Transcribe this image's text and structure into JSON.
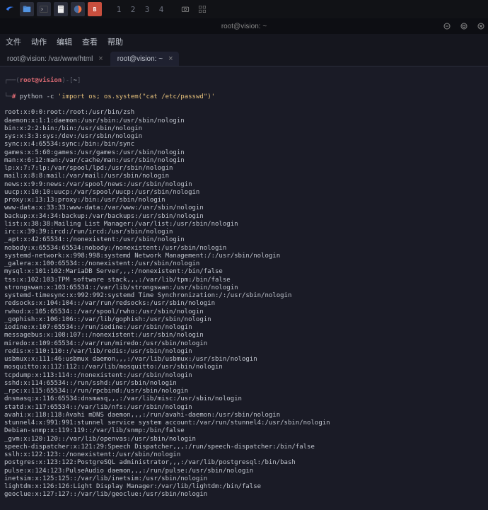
{
  "taskbar": {
    "workspaces": [
      "1",
      "2",
      "3",
      "4"
    ]
  },
  "window": {
    "title": "root@vision: ~"
  },
  "menu": {
    "file": "文件",
    "actions": "动作",
    "edit": "编辑",
    "view": "查看",
    "help": "帮助"
  },
  "tabs": [
    {
      "label": "root@vision: /var/www/html",
      "active": false
    },
    {
      "label": "root@vision: ~",
      "active": true
    }
  ],
  "prompt": {
    "user": "root",
    "at": "@",
    "host": "vision",
    "path": "~",
    "marker": "#",
    "corner_top": "┌──(",
    "corner_mid": ")-[",
    "corner_end": "]",
    "corner_bot": "└─"
  },
  "command": {
    "bin": "python",
    "flag": "-c",
    "q1": "'",
    "code": "import os; os.system(",
    "q2": "\"",
    "arg": "cat /etc/passwd",
    "q3": "\"",
    "close": ")",
    "q4": "'"
  },
  "output": [
    "root:x:0:0:root:/root:/usr/bin/zsh",
    "daemon:x:1:1:daemon:/usr/sbin:/usr/sbin/nologin",
    "bin:x:2:2:bin:/bin:/usr/sbin/nologin",
    "sys:x:3:3:sys:/dev:/usr/sbin/nologin",
    "sync:x:4:65534:sync:/bin:/bin/sync",
    "games:x:5:60:games:/usr/games:/usr/sbin/nologin",
    "man:x:6:12:man:/var/cache/man:/usr/sbin/nologin",
    "lp:x:7:7:lp:/var/spool/lpd:/usr/sbin/nologin",
    "mail:x:8:8:mail:/var/mail:/usr/sbin/nologin",
    "news:x:9:9:news:/var/spool/news:/usr/sbin/nologin",
    "uucp:x:10:10:uucp:/var/spool/uucp:/usr/sbin/nologin",
    "proxy:x:13:13:proxy:/bin:/usr/sbin/nologin",
    "www-data:x:33:33:www-data:/var/www:/usr/sbin/nologin",
    "backup:x:34:34:backup:/var/backups:/usr/sbin/nologin",
    "list:x:38:38:Mailing List Manager:/var/list:/usr/sbin/nologin",
    "irc:x:39:39:ircd:/run/ircd:/usr/sbin/nologin",
    "_apt:x:42:65534::/nonexistent:/usr/sbin/nologin",
    "nobody:x:65534:65534:nobody:/nonexistent:/usr/sbin/nologin",
    "systemd-network:x:998:998:systemd Network Management:/:/usr/sbin/nologin",
    "_galera:x:100:65534::/nonexistent:/usr/sbin/nologin",
    "mysql:x:101:102:MariaDB Server,,,:/nonexistent:/bin/false",
    "tss:x:102:103:TPM software stack,,,:/var/lib/tpm:/bin/false",
    "strongswan:x:103:65534::/var/lib/strongswan:/usr/sbin/nologin",
    "systemd-timesync:x:992:992:systemd Time Synchronization:/:/usr/sbin/nologin",
    "redsocks:x:104:104::/var/run/redsocks:/usr/sbin/nologin",
    "rwhod:x:105:65534::/var/spool/rwho:/usr/sbin/nologin",
    "_gophish:x:106:106::/var/lib/gophish:/usr/sbin/nologin",
    "iodine:x:107:65534::/run/iodine:/usr/sbin/nologin",
    "messagebus:x:108:107::/nonexistent:/usr/sbin/nologin",
    "miredo:x:109:65534::/var/run/miredo:/usr/sbin/nologin",
    "redis:x:110:110::/var/lib/redis:/usr/sbin/nologin",
    "usbmux:x:111:46:usbmux daemon,,,:/var/lib/usbmux:/usr/sbin/nologin",
    "mosquitto:x:112:112::/var/lib/mosquitto:/usr/sbin/nologin",
    "tcpdump:x:113:114::/nonexistent:/usr/sbin/nologin",
    "sshd:x:114:65534::/run/sshd:/usr/sbin/nologin",
    "_rpc:x:115:65534::/run/rpcbind:/usr/sbin/nologin",
    "dnsmasq:x:116:65534:dnsmasq,,,:/var/lib/misc:/usr/sbin/nologin",
    "statd:x:117:65534::/var/lib/nfs:/usr/sbin/nologin",
    "avahi:x:118:118:Avahi mDNS daemon,,,:/run/avahi-daemon:/usr/sbin/nologin",
    "stunnel4:x:991:991:stunnel service system account:/var/run/stunnel4:/usr/sbin/nologin",
    "Debian-snmp:x:119:119::/var/lib/snmp:/bin/false",
    "_gvm:x:120:120::/var/lib/openvas:/usr/sbin/nologin",
    "speech-dispatcher:x:121:29:Speech Dispatcher,,,:/run/speech-dispatcher:/bin/false",
    "sslh:x:122:123::/nonexistent:/usr/sbin/nologin",
    "postgres:x:123:122:PostgreSQL administrator,,,:/var/lib/postgresql:/bin/bash",
    "pulse:x:124:123:PulseAudio daemon,,,:/run/pulse:/usr/sbin/nologin",
    "inetsim:x:125:125::/var/lib/inetsim:/usr/sbin/nologin",
    "lightdm:x:126:126:Light Display Manager:/var/lib/lightdm:/bin/false",
    "geoclue:x:127:127::/var/lib/geoclue:/usr/sbin/nologin"
  ]
}
